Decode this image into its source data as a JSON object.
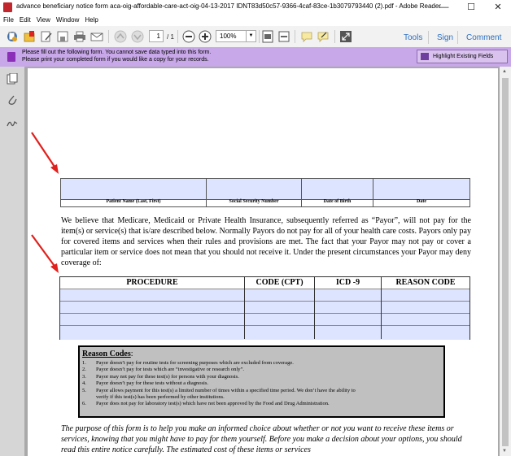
{
  "window": {
    "title": "advance beneficiary notice form aca-oig-affordable-care-act-oig-04-13-2017 IDNT83d50c57-9366-4caf-83ce-1b3079793440 (2).pdf - Adobe Reader",
    "minimize": "—",
    "maximize": "☐",
    "close": "✕"
  },
  "menu": [
    "File",
    "Edit",
    "View",
    "Window",
    "Help"
  ],
  "toolbar": {
    "page_current": "1",
    "page_total": "/ 1",
    "zoom": "100%",
    "tools_label": "Tools",
    "sign_label": "Sign",
    "comment_label": "Comment"
  },
  "notice": {
    "line1": "Please fill out the following form. You cannot save data typed into this form.",
    "line2": "Please print your completed form if you would like a copy for your records.",
    "highlight_button": "Highlight Existing Fields"
  },
  "form": {
    "patient_headers": [
      "Patient Name (Last, First)",
      "Social Security Number",
      "Date of Birth",
      "Date"
    ],
    "paragraph": "We believe that Medicare, Medicaid or Private Health Insurance, subsequently referred as “Payor”, will not pay for the item(s) or service(s) that is/are described below.  Normally Payors do not pay for all of your health care costs.  Payors only pay for covered items and services when their rules and provisions are met.  The fact that your Payor may not pay or cover a particular item or service does not mean that you should not receive it.  Under the present circumstances your Payor may deny coverage of:",
    "procedure_headers": [
      "PROCEDURE",
      "CODE (CPT)",
      "ICD -9",
      "REASON CODE"
    ],
    "reason_title": "Reason Codes",
    "reason_colon": ":",
    "reasons": [
      {
        "num": "1.",
        "text": "Payor doesn’t pay for routine tests for screening purposes which are excluded from coverage."
      },
      {
        "num": "2.",
        "text": "Payor doesn’t pay for tests which are “investigative or research only”."
      },
      {
        "num": "3.",
        "text": "Payor may not pay for these test(s) for persons with your diagnosis."
      },
      {
        "num": "4.",
        "text": "Payor doesn’t pay for these tests without a diagnosis."
      },
      {
        "num": "5.",
        "text": "Payor allows payment for this test(s) a limited number of times within a specified time period.  We don’t have the ability to"
      },
      {
        "num": "",
        "text": "verify if this test(s) has been performed by other institutions."
      },
      {
        "num": "6.",
        "text": "Payor does not pay for laboratory test(s) which have not been approved by the Food and Drug Administration."
      }
    ],
    "italic_paragraph": "The purpose of this form is to help you make an informed choice about whether or not you want to receive these items or services, knowing that you might have to pay for them yourself.  Before you make a decision about your options, you should read this entire notice carefully.  The estimated cost of these items or services"
  },
  "colors": {
    "notice_bg": "#c8a8e8",
    "field_fill": "#dde4ff",
    "link_blue": "#2a6ebf",
    "arrow_red": "#e0201c",
    "reason_bg": "#c0c0c0"
  }
}
